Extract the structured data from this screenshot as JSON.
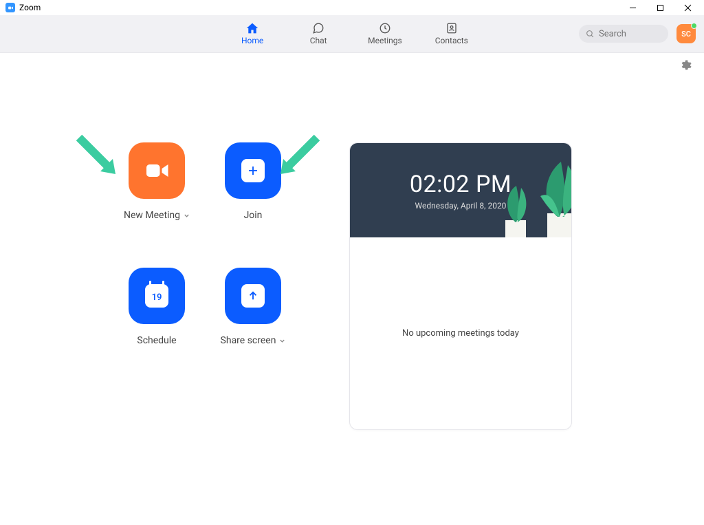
{
  "app": {
    "title": "Zoom"
  },
  "tabs": [
    {
      "id": "home",
      "label": "Home",
      "active": true
    },
    {
      "id": "chat",
      "label": "Chat",
      "active": false
    },
    {
      "id": "meetings",
      "label": "Meetings",
      "active": false
    },
    {
      "id": "contacts",
      "label": "Contacts",
      "active": false
    }
  ],
  "search": {
    "placeholder": "Search"
  },
  "avatar": {
    "initials": "SC",
    "status": "online"
  },
  "actions": {
    "new_meeting": {
      "label": "New Meeting",
      "has_menu": true
    },
    "join": {
      "label": "Join",
      "has_menu": false
    },
    "schedule": {
      "label": "Schedule",
      "has_menu": false,
      "day_number": "19"
    },
    "share_screen": {
      "label": "Share screen",
      "has_menu": true
    }
  },
  "clock": {
    "time": "02:02 PM",
    "date": "Wednesday, April 8, 2020"
  },
  "upcoming": {
    "empty_text": "No upcoming meetings today"
  },
  "colors": {
    "accent_blue": "#0b5cff",
    "accent_orange": "#ff742e",
    "arrow_green": "#3bcca0"
  }
}
